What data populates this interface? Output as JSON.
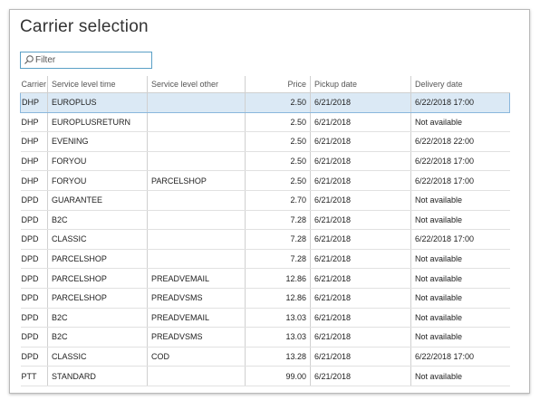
{
  "dialog": {
    "title": "Carrier selection"
  },
  "filter": {
    "placeholder": "Filter",
    "icon": "search-icon"
  },
  "table": {
    "headers": [
      "Carrier",
      "Service level time",
      "Service level other",
      "Price",
      "Pickup date",
      "Delivery date"
    ],
    "selected_row": 0,
    "rows": [
      [
        "DHP",
        "EUROPLUS",
        "",
        "2.50",
        "6/21/2018",
        "6/22/2018 17:00"
      ],
      [
        "DHP",
        "EUROPLUSRETURN",
        "",
        "2.50",
        "6/21/2018",
        "Not available"
      ],
      [
        "DHP",
        "EVENING",
        "",
        "2.50",
        "6/21/2018",
        "6/22/2018 22:00"
      ],
      [
        "DHP",
        "FORYOU",
        "",
        "2.50",
        "6/21/2018",
        "6/22/2018 17:00"
      ],
      [
        "DHP",
        "FORYOU",
        "PARCELSHOP",
        "2.50",
        "6/21/2018",
        "6/22/2018 17:00"
      ],
      [
        "DPD",
        "GUARANTEE",
        "",
        "2.70",
        "6/21/2018",
        "Not available"
      ],
      [
        "DPD",
        "B2C",
        "",
        "7.28",
        "6/21/2018",
        "Not available"
      ],
      [
        "DPD",
        "CLASSIC",
        "",
        "7.28",
        "6/21/2018",
        "6/22/2018 17:00"
      ],
      [
        "DPD",
        "PARCELSHOP",
        "",
        "7.28",
        "6/21/2018",
        "Not available"
      ],
      [
        "DPD",
        "PARCELSHOP",
        "PREADVEMAIL",
        "12.86",
        "6/21/2018",
        "Not available"
      ],
      [
        "DPD",
        "PARCELSHOP",
        "PREADVSMS",
        "12.86",
        "6/21/2018",
        "Not available"
      ],
      [
        "DPD",
        "B2C",
        "PREADVEMAIL",
        "13.03",
        "6/21/2018",
        "Not available"
      ],
      [
        "DPD",
        "B2C",
        "PREADVSMS",
        "13.03",
        "6/21/2018",
        "Not available"
      ],
      [
        "DPD",
        "CLASSIC",
        "COD",
        "13.28",
        "6/21/2018",
        "6/22/2018 17:00"
      ],
      [
        "PTT",
        "STANDARD",
        "",
        "99.00",
        "6/21/2018",
        "Not available"
      ]
    ]
  }
}
